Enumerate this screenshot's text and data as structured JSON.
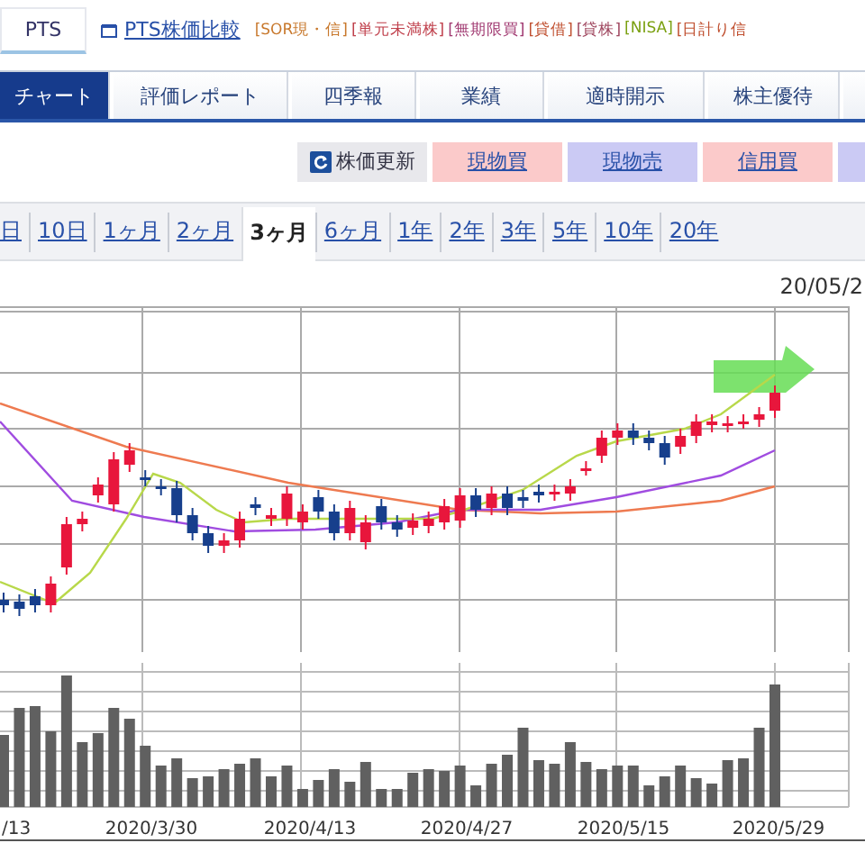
{
  "header": {
    "pts_tab": "PTS",
    "compare_link": "PTS株価比較",
    "tags": [
      {
        "label": "[SOR現・信]",
        "color": "#c8782c"
      },
      {
        "label": "[単元未満株]",
        "color": "#c0404c"
      },
      {
        "label": "[無期限買]",
        "color": "#a03870"
      },
      {
        "label": "[貸借]",
        "color": "#c05030"
      },
      {
        "label": "[貸株]",
        "color": "#a04860"
      },
      {
        "label": "[NISA]",
        "color": "#7aa010"
      },
      {
        "label": "[日計り信",
        "color": "#c05030"
      }
    ]
  },
  "tabs": [
    {
      "label": "チャート",
      "selected": true
    },
    {
      "label": "評価レポート",
      "selected": false
    },
    {
      "label": "四季報",
      "selected": false
    },
    {
      "label": "業績",
      "selected": false
    },
    {
      "label": "適時開示",
      "selected": false
    },
    {
      "label": "株主優待",
      "selected": false
    }
  ],
  "actions": [
    {
      "label": "株価更新",
      "kind": "refresh"
    },
    {
      "label": "現物買",
      "kind": "buy"
    },
    {
      "label": "現物売",
      "kind": "sell"
    },
    {
      "label": "信用買",
      "kind": "buy"
    }
  ],
  "periods": [
    {
      "label": "日",
      "selected": false
    },
    {
      "label": "10日",
      "selected": false
    },
    {
      "label": "1ヶ月",
      "selected": false
    },
    {
      "label": "2ヶ月",
      "selected": false
    },
    {
      "label": "3ヶ月",
      "selected": true
    },
    {
      "label": "6ヶ月",
      "selected": false
    },
    {
      "label": "1年",
      "selected": false
    },
    {
      "label": "2年",
      "selected": false
    },
    {
      "label": "3年",
      "selected": false
    },
    {
      "label": "5年",
      "selected": false
    },
    {
      "label": "10年",
      "selected": false
    },
    {
      "label": "20年",
      "selected": false
    }
  ],
  "chart": {
    "date": "20/05/2",
    "x_labels": [
      "/13",
      "2020/3/30",
      "2020/4/13",
      "2020/4/27",
      "2020/5/15",
      "2020/5/29"
    ]
  }
}
